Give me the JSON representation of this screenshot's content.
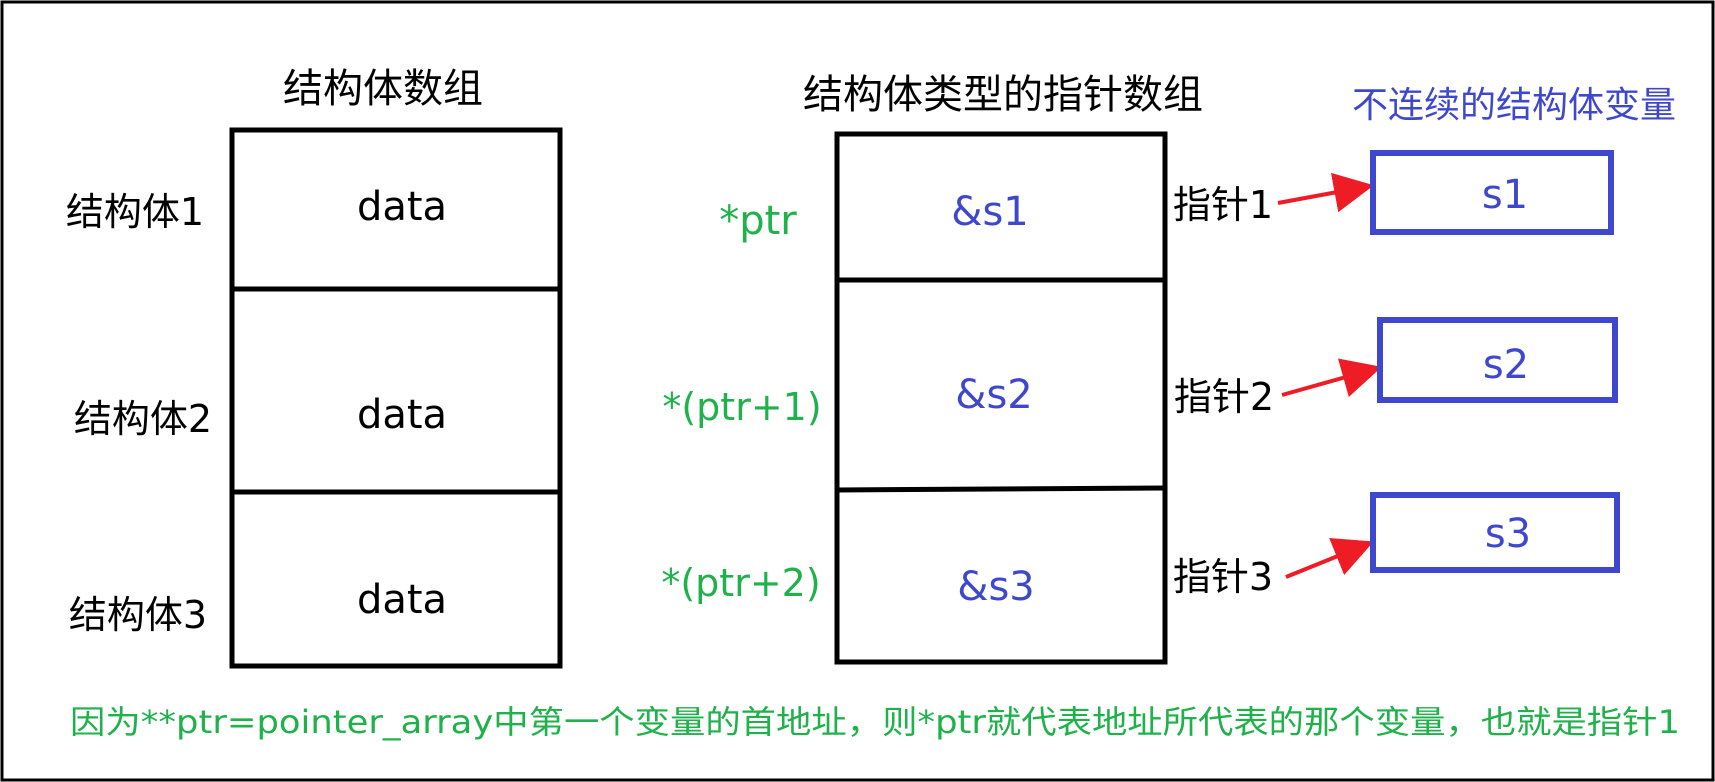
{
  "colors": {
    "black": "#000000",
    "green": "#1fb14a",
    "blue": "#3f48cc",
    "red": "#ee1c25"
  },
  "struct_array": {
    "title": "结构体数组",
    "row_labels": [
      "结构体1",
      "结构体2",
      "结构体3"
    ],
    "cells": [
      "data",
      "data",
      "data"
    ]
  },
  "pointer_array": {
    "title": "结构体类型的指针数组",
    "row_labels": [
      "*ptr",
      "*(ptr+1)",
      "*(ptr+2)"
    ],
    "cells": [
      "&s1",
      "&s2",
      "&s3"
    ],
    "pointer_labels": [
      "指针1",
      "指针2",
      "指针3"
    ]
  },
  "struct_vars": {
    "title": "不连续的结构体变量",
    "items": [
      "s1",
      "s2",
      "s3"
    ]
  },
  "footer_note": "因为**ptr=pointer_array中第一个变量的首地址，则*ptr就代表地址所代表的那个变量，也就是指针1"
}
